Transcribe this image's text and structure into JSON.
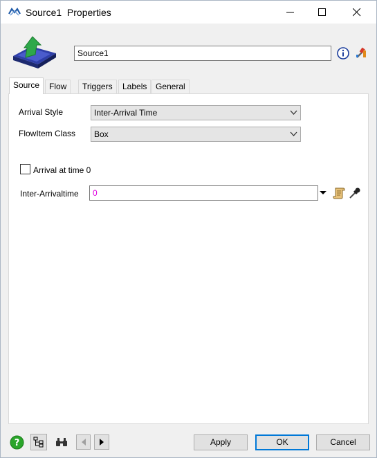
{
  "window": {
    "title": "Source1  Properties",
    "controls": {
      "minimize": "minimize-icon",
      "maximize": "maximize-icon",
      "close": "close-icon"
    }
  },
  "header": {
    "object_name": "Source1",
    "object_icon": "source-object-icon",
    "info_icon": "info-icon",
    "tools_icon": "tools-icon"
  },
  "tabs": [
    {
      "label": "Source",
      "active": true
    },
    {
      "label": "Flow",
      "active": false
    },
    {
      "label": "Triggers",
      "active": false
    },
    {
      "label": "Labels",
      "active": false
    },
    {
      "label": "General",
      "active": false
    }
  ],
  "source_tab": {
    "arrival_style": {
      "label": "Arrival Style",
      "value": "Inter-Arrival Time"
    },
    "flowitem_class": {
      "label": "FlowItem Class",
      "value": "Box"
    },
    "arrival_at_time_zero": {
      "label": "Arrival at time 0",
      "checked": false
    },
    "inter_arrival_time": {
      "label": "Inter-Arrivaltime",
      "value": "0"
    }
  },
  "footer": {
    "help_icon": "help-icon",
    "tree_icon": "tree-view-icon",
    "find_icon": "binoculars-icon",
    "apply_label": "Apply",
    "ok_label": "OK",
    "cancel_label": "Cancel"
  },
  "colors": {
    "accent": "#0078d7",
    "value_text": "#e000e0",
    "help_green": "#2aa52a"
  }
}
